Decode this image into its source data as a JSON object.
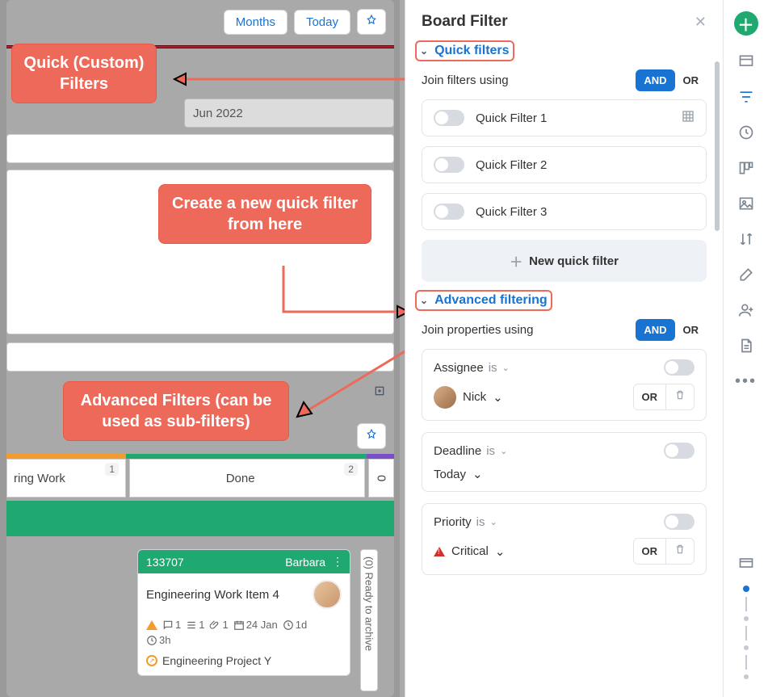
{
  "board": {
    "months_btn": "Months",
    "today_btn": "Today",
    "month_label": "Jun 2022",
    "columns": {
      "col1": {
        "label": "ring Work",
        "count": "1"
      },
      "col2": {
        "label": "Done",
        "count": "2"
      },
      "col3": {
        "label": "0"
      }
    },
    "archive_label": "(0) Ready to archive"
  },
  "card": {
    "id": "133707",
    "owner": "Barbara",
    "title": "Engineering Work Item 4",
    "comments": "1",
    "subtasks": "1",
    "attachments": "1",
    "date": "24 Jan",
    "duration": "1d",
    "hours": "3h",
    "link": "Engineering Project Y"
  },
  "annotations": {
    "a1": "Quick (Custom) Filters",
    "a2": "Create a new quick filter from here",
    "a3": "Advanced Filters (can be used as sub-filters)"
  },
  "panel": {
    "title": "Board Filter",
    "quick_filters_label": "Quick filters",
    "join_filters_label": "Join filters using",
    "and": "AND",
    "or": "OR",
    "filters": [
      "Quick Filter 1",
      "Quick Filter 2",
      "Quick Filter 3"
    ],
    "new_filter": "New quick filter",
    "advanced_label": "Advanced filtering",
    "join_props_label": "Join properties using",
    "properties": [
      {
        "name": "Assignee",
        "op": "is",
        "value": "Nick",
        "value_type": "user"
      },
      {
        "name": "Deadline",
        "op": "is",
        "value": "Today",
        "value_type": "text"
      },
      {
        "name": "Priority",
        "op": "is",
        "value": "Critical",
        "value_type": "priority"
      }
    ]
  }
}
